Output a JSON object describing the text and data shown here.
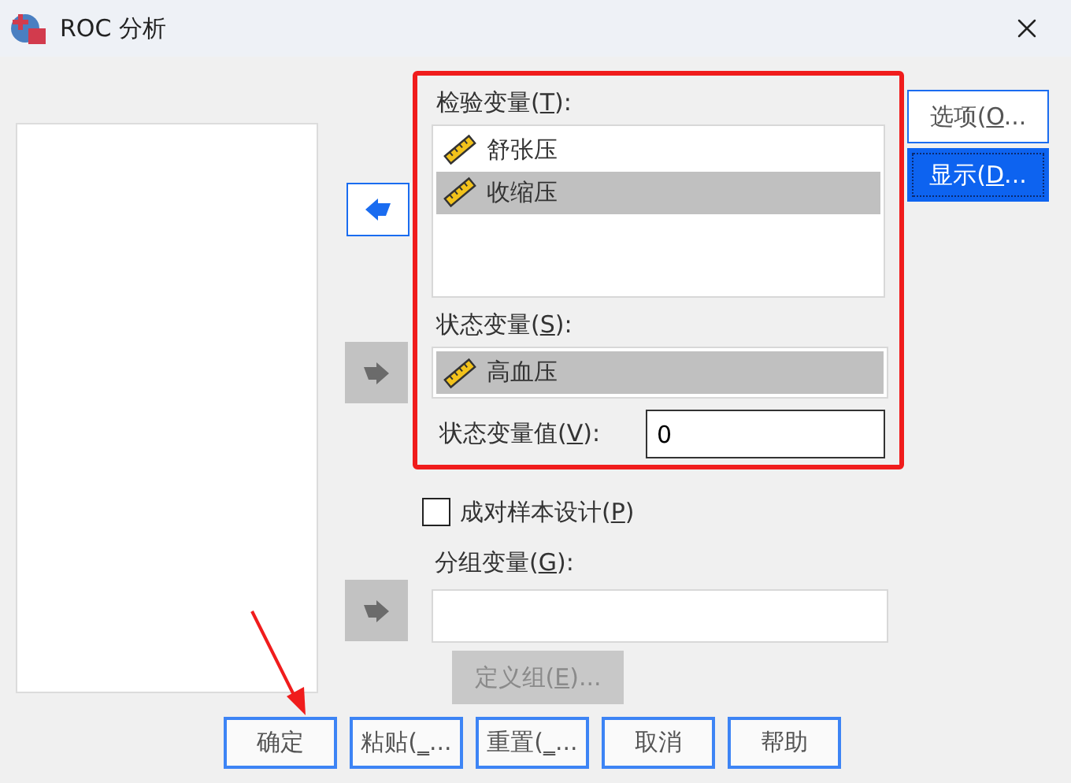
{
  "window": {
    "title": "ROC 分析"
  },
  "move_buttons": [
    {
      "kind": "remove",
      "disabled": false
    },
    {
      "kind": "add",
      "disabled": true
    },
    {
      "kind": "add",
      "disabled": true
    }
  ],
  "test_variables": {
    "label": {
      "before": "检验变量(",
      "key": "T",
      "after": "):"
    },
    "items": [
      {
        "name": "舒张压",
        "selected": false
      },
      {
        "name": "收缩压",
        "selected": true
      }
    ]
  },
  "state_variable": {
    "label": {
      "before": "状态变量(",
      "key": "S",
      "after": "):"
    },
    "items": [
      {
        "name": "高血压",
        "selected": true
      }
    ]
  },
  "state_value": {
    "label": {
      "before": "状态变量值(",
      "key": "V",
      "after": "):"
    },
    "value": "0"
  },
  "paired_design": {
    "label": {
      "before": "成对样本设计(",
      "key": "P",
      "after": ")"
    },
    "checked": false
  },
  "grouping_variable": {
    "label": {
      "before": "分组变量(",
      "key": "G",
      "after": "):"
    }
  },
  "define_groups": {
    "label": {
      "before": "定义组(",
      "key": "E",
      "after": ")..."
    },
    "disabled": true
  },
  "side_buttons": [
    {
      "label": {
        "before": "选项(",
        "key": "O",
        "after": "..."
      },
      "focused": false
    },
    {
      "label": {
        "before": "显示(",
        "key": "D",
        "after": "..."
      },
      "focused": true
    }
  ],
  "bottom_buttons": [
    {
      "label": {
        "before": "确定"
      }
    },
    {
      "label": {
        "before": "粘贴(",
        "key": "_",
        "after": "..."
      }
    },
    {
      "label": {
        "before": "重置(",
        "key": "_",
        "after": "..."
      }
    },
    {
      "label": {
        "before": "取消"
      }
    },
    {
      "label": {
        "before": "帮助"
      }
    }
  ]
}
